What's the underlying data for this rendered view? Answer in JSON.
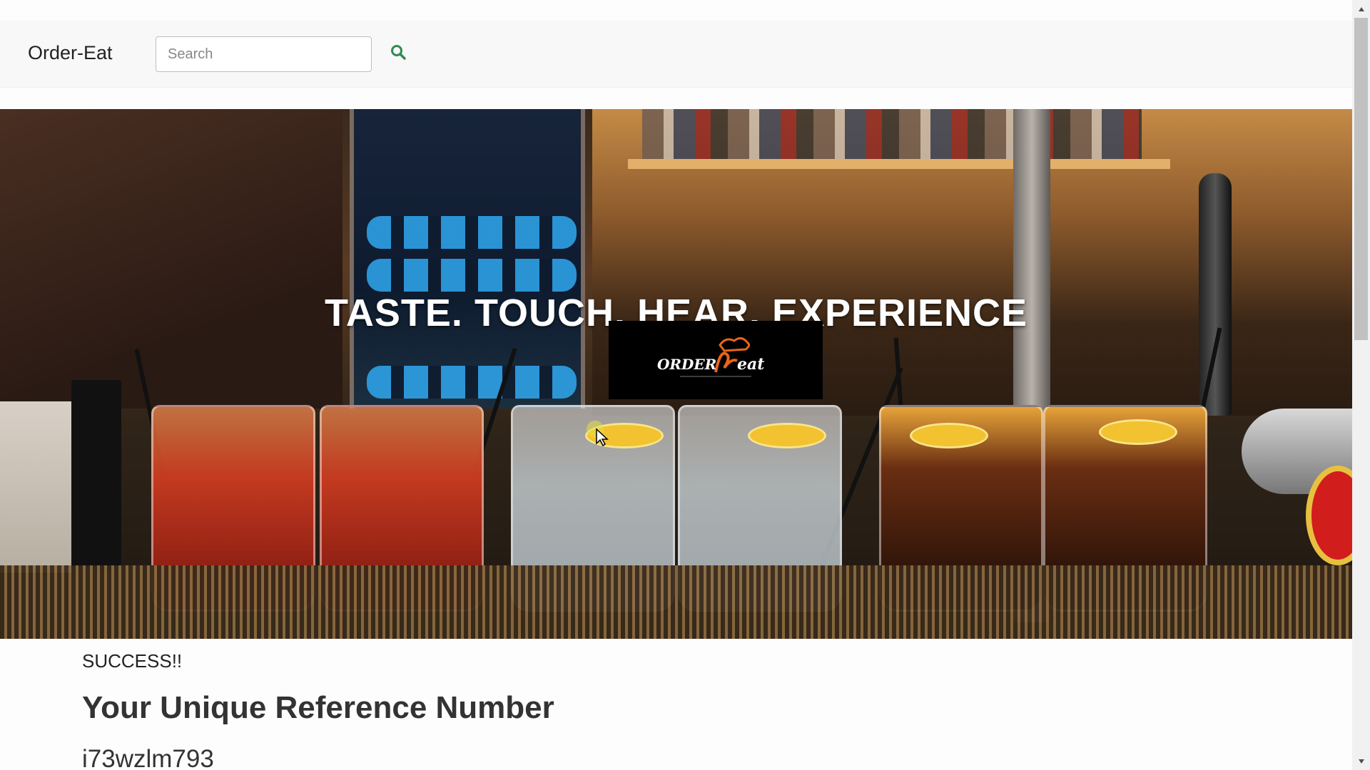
{
  "navbar": {
    "brand": "Order-Eat",
    "search_placeholder": "Search",
    "search_icon": "search-icon"
  },
  "hero": {
    "tagline": "TASTE. TOUCH. HEAR. EXPERIENCE",
    "logo_alt": "Order Eat logo"
  },
  "content": {
    "status": "SUCCESS!!",
    "ref_heading": "Your Unique Reference Number",
    "ref_number": "i73wzlm793"
  },
  "colors": {
    "search_icon": "#2e8b57",
    "navbar_bg": "#f8f8f8",
    "logo_accent": "#e8651a"
  }
}
